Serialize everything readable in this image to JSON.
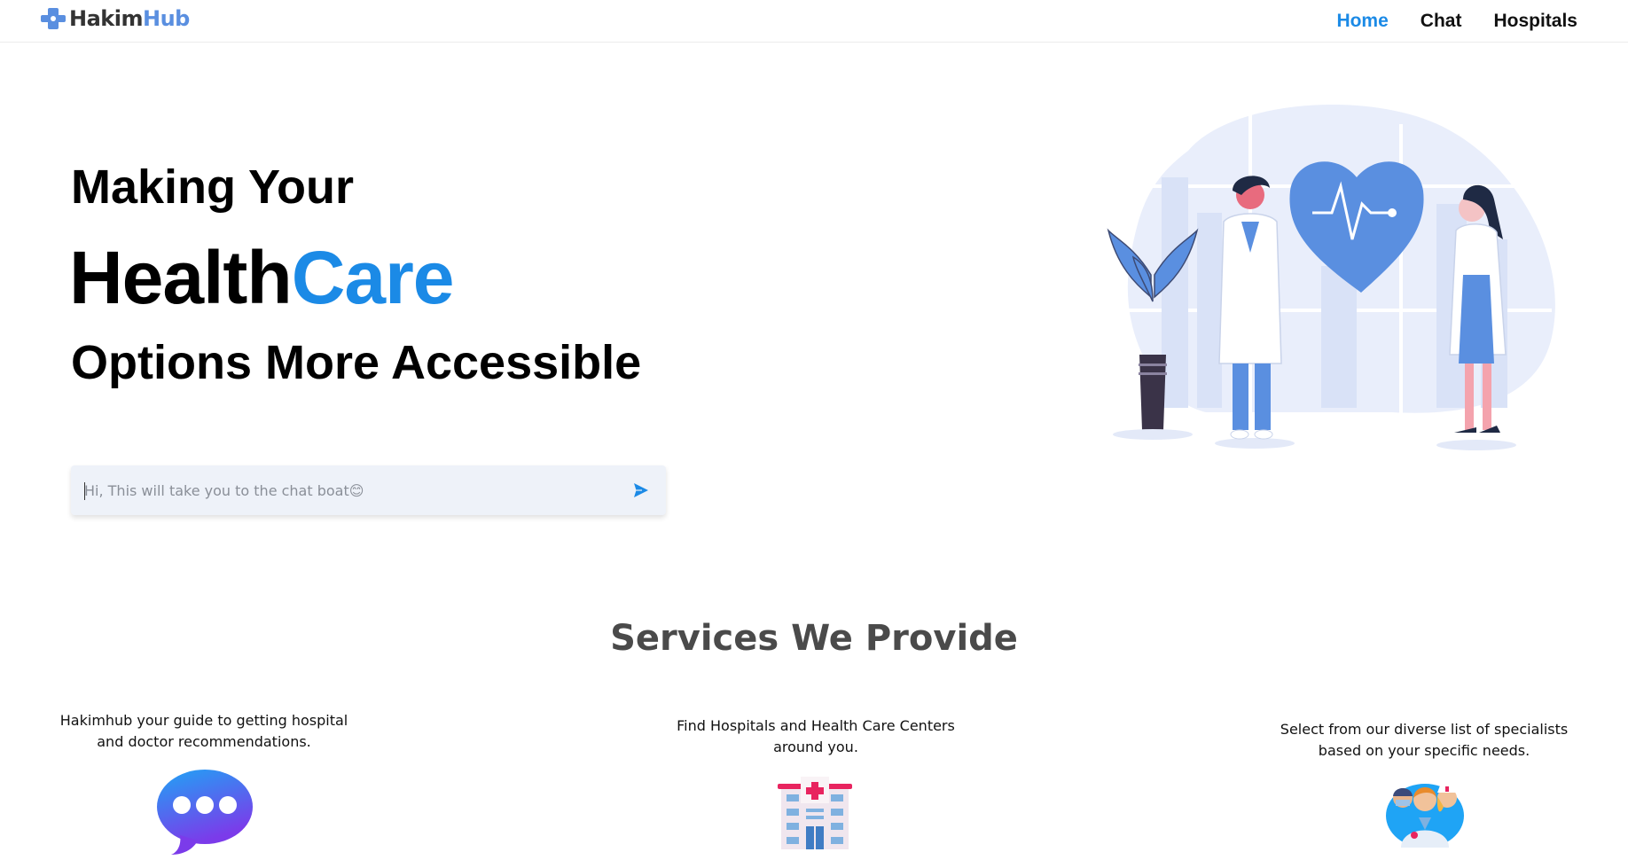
{
  "nav": {
    "logo_part1": "Hakim",
    "logo_part2": "Hub",
    "links": [
      {
        "label": "Home",
        "active": true
      },
      {
        "label": "Chat",
        "active": false
      },
      {
        "label": "Hospitals",
        "active": false
      }
    ]
  },
  "hero": {
    "line1": "Making Your",
    "line2_a": "Health",
    "line2_b": "Care",
    "line3": "Options More Accessible"
  },
  "chat": {
    "placeholder": "Hi, This will take you to the chat boat😊",
    "send_icon": "send-icon"
  },
  "services": {
    "title": "Services We Provide",
    "items": [
      {
        "text": "Hakimhub your guide to getting hospital and doctor recommendations.",
        "icon": "chat-bubble-icon"
      },
      {
        "text": "Find Hospitals and Health Care Centers around you.",
        "icon": "hospital-icon"
      },
      {
        "text": "Select from our diverse list of specialists based on your specific needs.",
        "icon": "doctors-icon"
      }
    ]
  },
  "colors": {
    "accent": "#1b8ae6",
    "logo_blue": "#5a8fe0",
    "input_bg": "#eef2f9"
  }
}
